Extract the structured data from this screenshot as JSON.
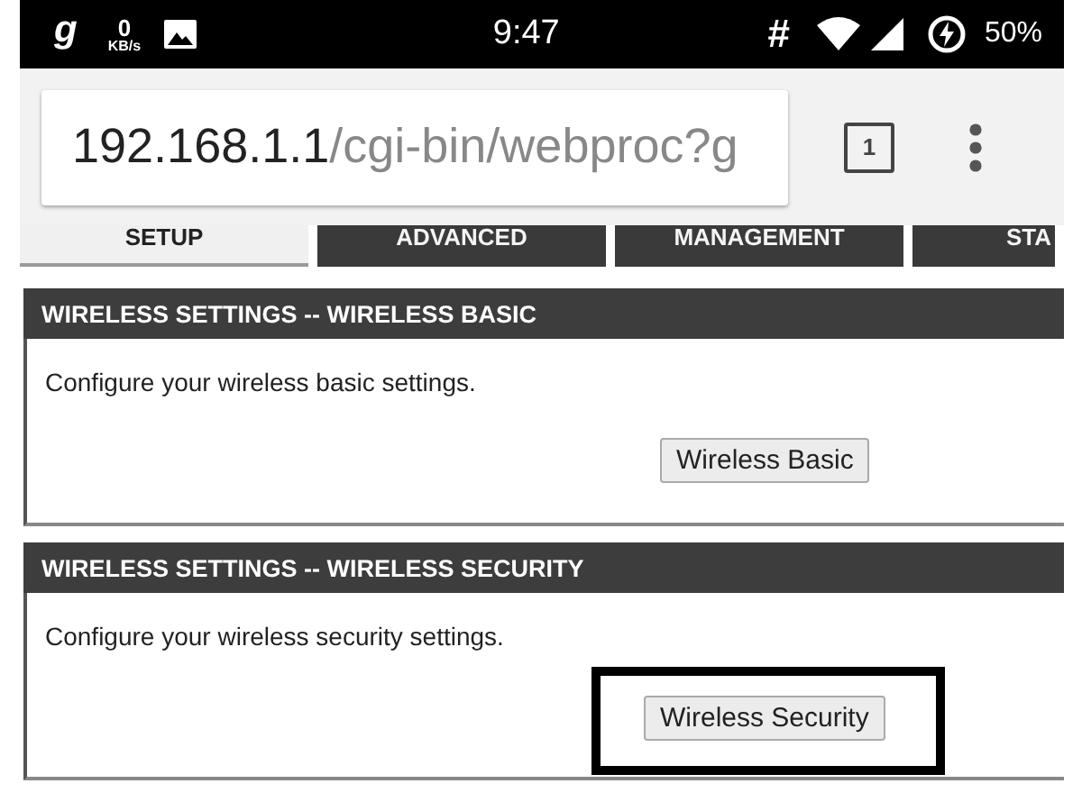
{
  "status_bar": {
    "app_letter": "g",
    "speed_value": "0",
    "speed_unit": "KB/s",
    "time": "9:47",
    "hash": "#",
    "battery": "50%"
  },
  "browser": {
    "url_host": "192.168.1.1",
    "url_path": "/cgi-bin/webproc?g",
    "tab_count": "1"
  },
  "tabs": [
    {
      "label": "SETUP",
      "selected": true
    },
    {
      "label": "ADVANCED",
      "selected": false
    },
    {
      "label": "MANAGEMENT",
      "selected": false
    },
    {
      "label": "STA",
      "selected": false
    }
  ],
  "sections": [
    {
      "title": "WIRELESS SETTINGS -- WIRELESS BASIC",
      "description": "Configure your wireless basic settings.",
      "button": "Wireless Basic",
      "highlighted": false
    },
    {
      "title": "WIRELESS SETTINGS -- WIRELESS SECURITY",
      "description": "Configure your wireless security settings.",
      "button": "Wireless Security",
      "highlighted": true
    }
  ]
}
